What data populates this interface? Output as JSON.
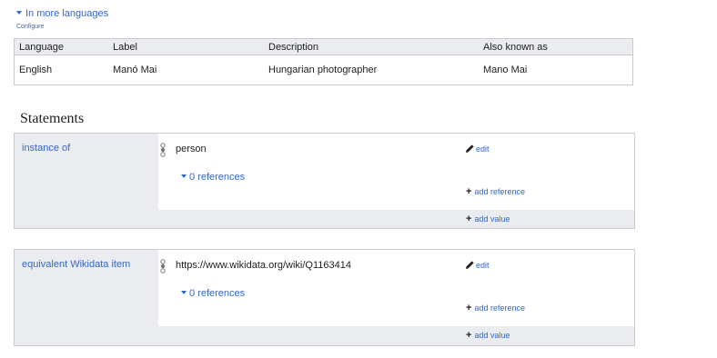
{
  "languages": {
    "toggle_label": "In more languages",
    "configure_label": "Configure",
    "headers": [
      "Language",
      "Label",
      "Description",
      "Also known as"
    ],
    "rows": [
      [
        "English",
        "Manó Mai",
        "Hungarian photographer",
        "Mano Mai"
      ]
    ]
  },
  "statements": {
    "heading": "Statements",
    "groups": [
      {
        "property": "instance of",
        "value": "person",
        "references_label": "0 references",
        "edit_label": "edit",
        "add_reference_label": "add reference",
        "add_value_label": "add value"
      },
      {
        "property": "equivalent Wikidata item",
        "value": "https://www.wikidata.org/wiki/Q1163414",
        "references_label": "0 references",
        "edit_label": "edit",
        "add_reference_label": "add reference",
        "add_value_label": "add value"
      }
    ]
  },
  "colors": {
    "link": "#3366cc",
    "border": "#c8ccd1",
    "panel_bg": "#eaecf0"
  },
  "icons": {
    "toggle": "triangle-down-icon",
    "rank": "rank-selector-icon",
    "edit": "pencil-icon",
    "add": "plus-icon"
  }
}
